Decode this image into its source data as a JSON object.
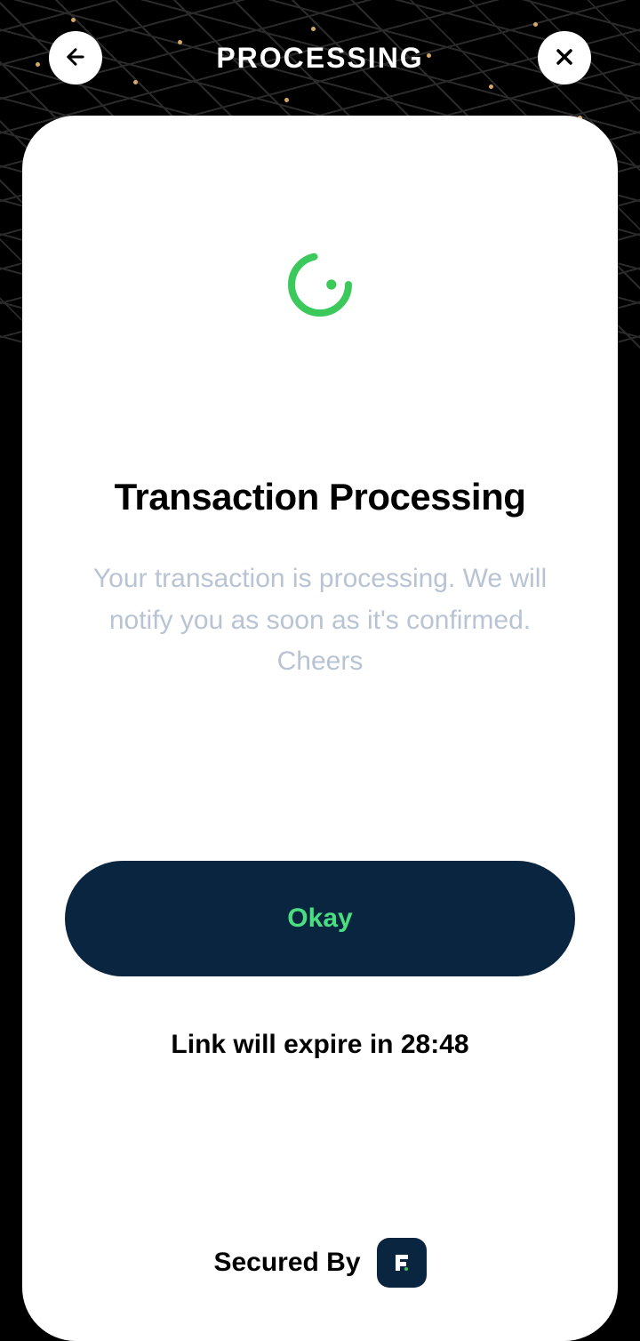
{
  "header": {
    "title": "PROCESSING"
  },
  "card": {
    "title": "Transaction Processing",
    "subtitle": "Your transaction is processing. We will notify you as soon as it's confirmed. Cheers",
    "button_label": "Okay",
    "expire_prefix": "Link will expire in ",
    "expire_time": "28:48",
    "secured_label": "Secured By"
  },
  "colors": {
    "accent_green": "#4ade80",
    "dark_navy": "#0a2540"
  }
}
